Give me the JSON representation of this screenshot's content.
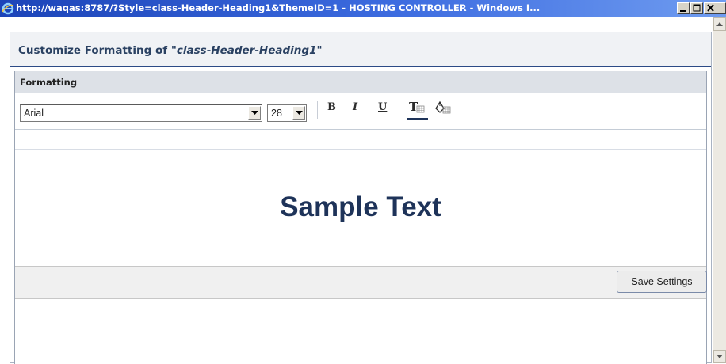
{
  "window": {
    "title": "http://waqas:8787/?Style=class-Header-Heading1&ThemeID=1 - HOSTING CONTROLLER - Windows I..."
  },
  "dialog": {
    "title_prefix": "Customize Formatting of ",
    "title_class": "\"class-Header-Heading1\""
  },
  "formatting": {
    "section_label": "Formatting",
    "font": {
      "selected": "Arial"
    },
    "size": {
      "selected": "28"
    },
    "bold_label": "B",
    "italic_label": "I",
    "underline_label": "U",
    "text_color_icon": "text-color-icon",
    "background_color_icon": "background-color-icon",
    "text_color": "#1e3359"
  },
  "preview": {
    "sample_text": "Sample Text"
  },
  "footer": {
    "save_label": "Save Settings"
  }
}
